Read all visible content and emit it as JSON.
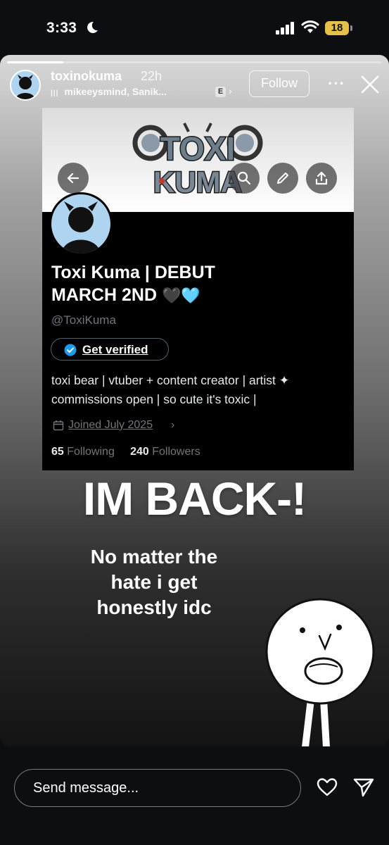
{
  "status_bar": {
    "time": "3:33",
    "battery": "18"
  },
  "story": {
    "progress": 0.15,
    "username": "toxinokuma",
    "time_ago": "22h",
    "audience": "mikeeysmind, Sanik...",
    "e_badge": "E",
    "follow_label": "Follow"
  },
  "profile": {
    "name_line1": "Toxi Kuma | DEBUT",
    "name_line2": "MARCH 2ND",
    "hearts": "🖤🩵",
    "handle": "@ToxiKuma",
    "verify_label": "Get verified",
    "bio_line1": "toxi bear | vtuber + content creator | artist ✦",
    "bio_line2": "commissions open | so cute it's toxic |",
    "joined": "Joined July 2025",
    "following_count": "65",
    "following_label": "Following",
    "followers_count": "240",
    "followers_label": "Followers",
    "logo_line1": "TOXI",
    "logo_line2": "KUMA"
  },
  "overlay": {
    "headline": "IM BACK-!",
    "sub_line1": "No matter the",
    "sub_line2": "hate i get",
    "sub_line3": "honestly idc"
  },
  "bottom": {
    "message_placeholder": "Send message..."
  }
}
